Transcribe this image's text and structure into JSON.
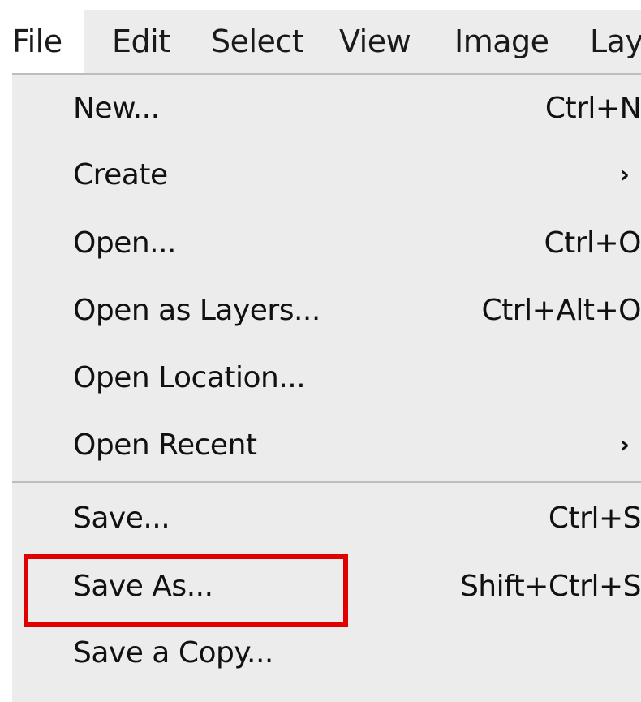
{
  "menubar": {
    "items": [
      "File",
      "Edit",
      "Select",
      "View",
      "Image",
      "Lay"
    ]
  },
  "menu": {
    "items": [
      {
        "label": "New...",
        "shortcut": "Ctrl+N"
      },
      {
        "label": "Create",
        "submenu": "chevron-right-icon",
        "glyph": "›"
      },
      {
        "label": "Open...",
        "shortcut": "Ctrl+O"
      },
      {
        "label": "Open as Layers...",
        "shortcut": "Ctrl+Alt+O"
      },
      {
        "label": "Open Location..."
      },
      {
        "label": "Open Recent",
        "submenu": "chevron-right-icon",
        "glyph": "›"
      },
      {
        "label": "Save...",
        "shortcut": "Ctrl+S"
      },
      {
        "label": "Save As...",
        "shortcut": "Shift+Ctrl+S",
        "highlighted": true
      },
      {
        "label": "Save a Copy..."
      }
    ]
  },
  "colors": {
    "menu_background": "#ececec",
    "highlight_outline": "#e00000",
    "separator": "#bdbdbd"
  }
}
